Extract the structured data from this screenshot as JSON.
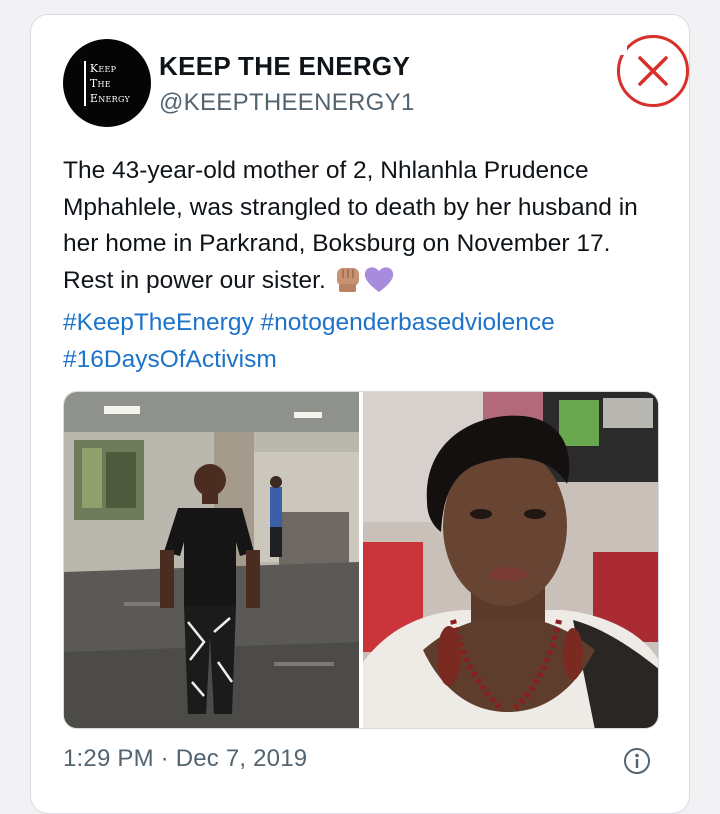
{
  "account": {
    "avatar_lines": [
      "Keep",
      "The",
      "Energy"
    ],
    "display_name": "KEEP THE ENERGY",
    "handle": "@KEEPTHEENERGY1"
  },
  "tweet": {
    "text": "The 43-year-old mother of 2, Nhlanhla Prudence Mphahlele, was strangled to death by her husband in her home in Parkrand, Boksburg on November 17. Rest in power our sister. ",
    "emojis": [
      "raised-fist-emoji",
      "purple-heart-emoji"
    ],
    "hashtags": [
      "#KeepTheEnergy",
      "#notogenderbasedviolence",
      "#16DaysOfActivism"
    ],
    "timestamp": "1:29 PM · Dec 7, 2019"
  },
  "media": {
    "photos": [
      "photo-woman-standing-in-lobby",
      "photo-woman-selfie"
    ]
  },
  "colors": {
    "link": "#1d73c9",
    "text": "#0f1419",
    "secondary": "#536471",
    "close_red": "#d92f2a",
    "border": "#d8dce0"
  },
  "icons": [
    "close-icon",
    "info-icon"
  ]
}
